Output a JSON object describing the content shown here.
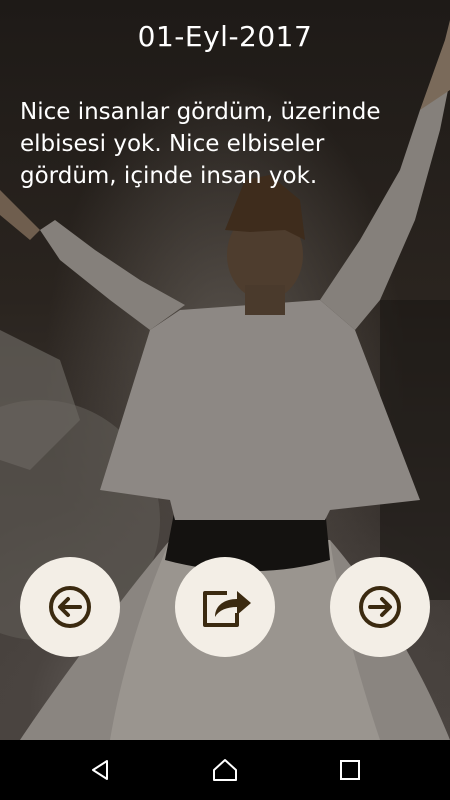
{
  "header": {
    "date": "01-Eyl-2017"
  },
  "quote": {
    "text": "Nice insanlar gördüm, üzerinde elbisesi yok. Nice elbiseler gördüm, içinde insan yok."
  },
  "actions": {
    "prev_icon": "arrow-left-circle-icon",
    "share_icon": "share-icon",
    "next_icon": "arrow-right-circle-icon"
  },
  "colors": {
    "button_bg": "#f3eee6",
    "icon": "#3b2a10",
    "text": "#ffffff",
    "navbar": "#000000"
  },
  "system_nav": {
    "back_icon": "back-triangle-icon",
    "home_icon": "home-icon",
    "recent_icon": "recent-apps-icon"
  }
}
